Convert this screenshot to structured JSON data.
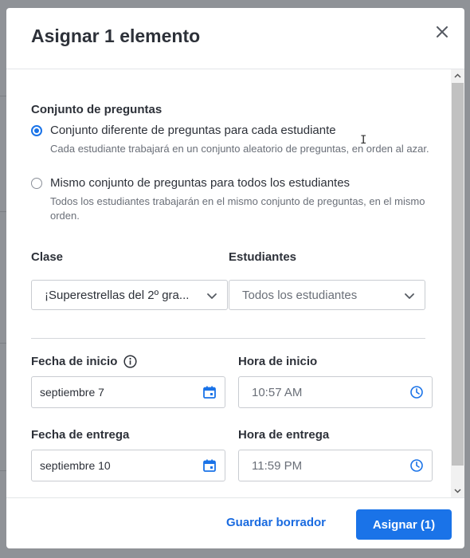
{
  "modal": {
    "title": "Asignar 1 elemento",
    "close_icon": "close-icon"
  },
  "question_set": {
    "label": "Conjunto de preguntas",
    "options": [
      {
        "label": "Conjunto diferente de preguntas para cada estudiante",
        "description": "Cada estudiante trabajará en un conjunto aleatorio de preguntas, en orden al azar.",
        "selected": true
      },
      {
        "label": "Mismo conjunto de preguntas para todos los estudiantes",
        "description": "Todos los estudiantes trabajarán en el mismo conjunto de preguntas, en el mismo orden.",
        "selected": false
      }
    ]
  },
  "class_field": {
    "label": "Clase",
    "value": "¡Superestrellas del 2º gra..."
  },
  "students_field": {
    "label": "Estudiantes",
    "placeholder": "Todos los estudiantes"
  },
  "start_date": {
    "label": "Fecha de inicio",
    "value": "septiembre 7",
    "info_icon": "info-icon"
  },
  "start_time": {
    "label": "Hora de inicio",
    "value": "10:57 AM"
  },
  "due_date": {
    "label": "Fecha de entrega",
    "value": "septiembre 10"
  },
  "due_time": {
    "label": "Hora de entrega",
    "value": "11:59 PM"
  },
  "footer": {
    "draft_label": "Guardar borrador",
    "assign_label": "Asignar (1)"
  },
  "colors": {
    "accent": "#1a73e8",
    "overlay": "#8f9297"
  }
}
